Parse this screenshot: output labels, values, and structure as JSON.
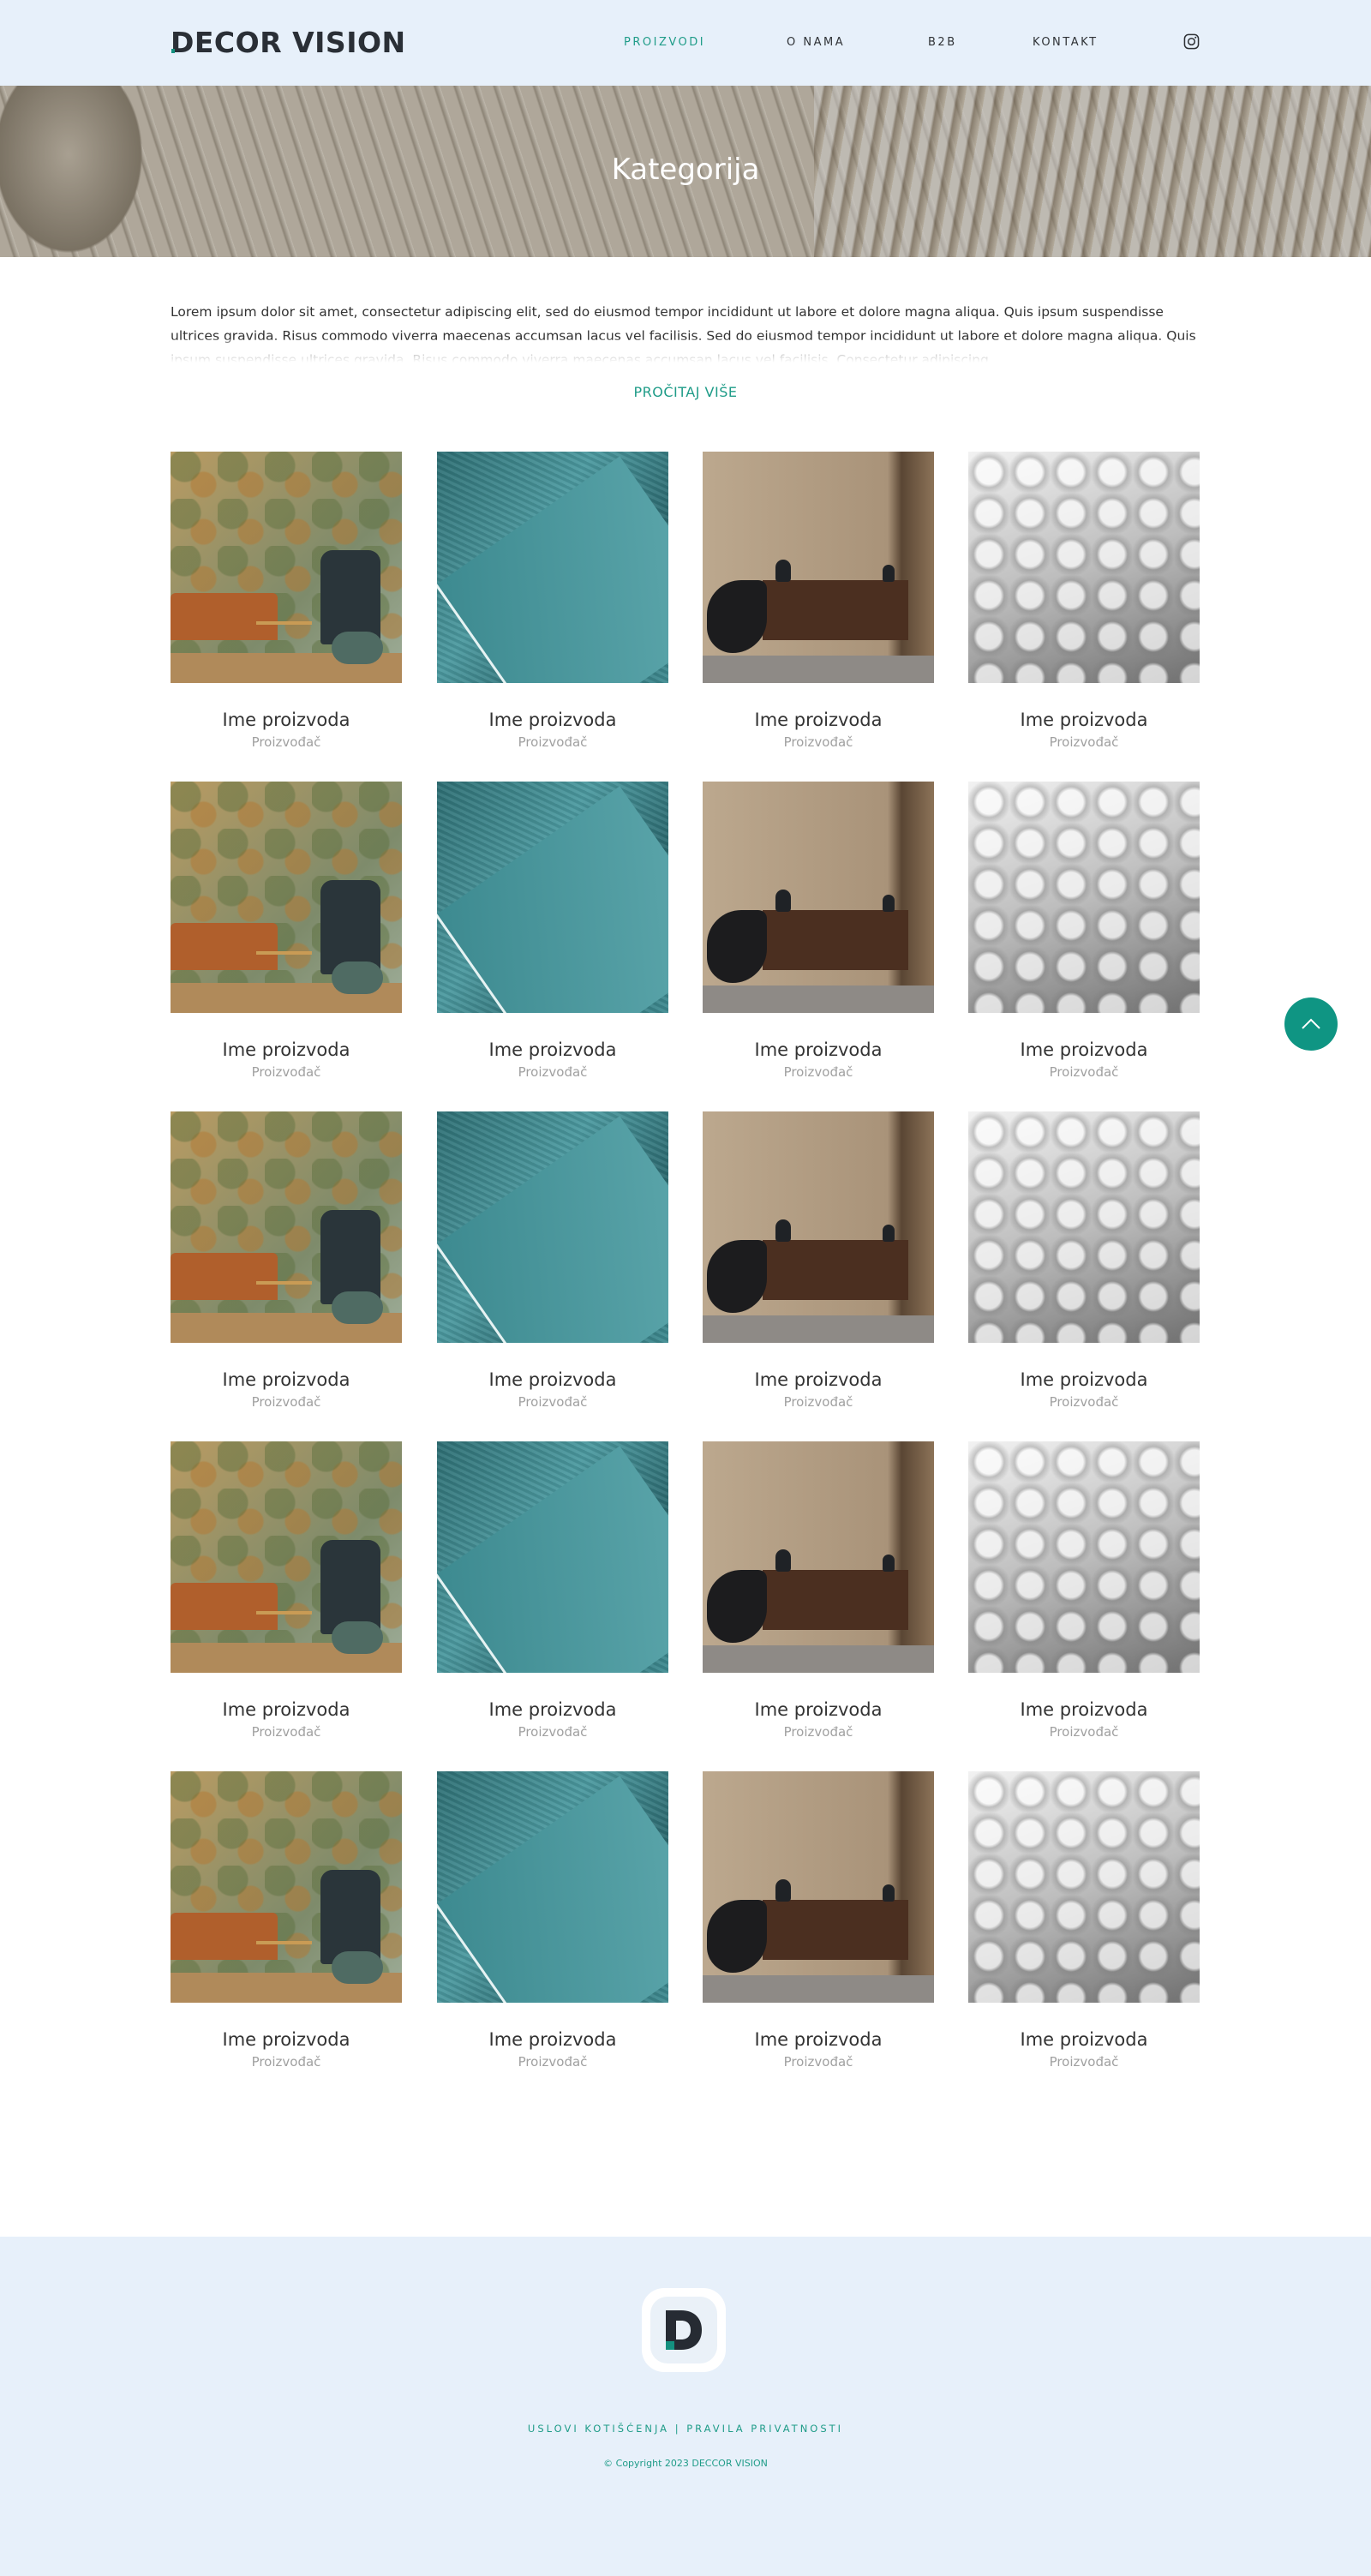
{
  "header": {
    "logo": "DECOR VISION",
    "nav": {
      "proizvodi": "PROIZVODI",
      "o_nama": "O NAMA",
      "b2b": "B2B",
      "kontakt": "KONTAKT"
    },
    "social_icon": "instagram-icon"
  },
  "hero": {
    "title": "Kategorija"
  },
  "intro": {
    "text": "Lorem ipsum dolor sit amet, consectetur adipiscing elit, sed do eiusmod tempor incididunt ut labore et dolore magna aliqua. Quis ipsum suspendisse ultrices gravida. Risus commodo viverra maecenas accumsan lacus vel facilisis. Sed do eiusmod tempor incididunt ut labore et dolore magna aliqua. Quis ipsum suspendisse ultrices gravida. Risus commodo viverra maecenas accumsan lacus vel facilisis. Consectetur adipiscing",
    "read_more": "PROČITAJ VIŠE"
  },
  "products": [
    {
      "name": "Ime proizvoda",
      "maker": "Proizvođač"
    },
    {
      "name": "Ime proizvoda",
      "maker": "Proizvođač"
    },
    {
      "name": "Ime proizvoda",
      "maker": "Proizvođač"
    },
    {
      "name": "Ime proizvoda",
      "maker": "Proizvođač"
    },
    {
      "name": "Ime proizvoda",
      "maker": "Proizvođač"
    },
    {
      "name": "Ime proizvoda",
      "maker": "Proizvođač"
    },
    {
      "name": "Ime proizvoda",
      "maker": "Proizvođač"
    },
    {
      "name": "Ime proizvoda",
      "maker": "Proizvođač"
    },
    {
      "name": "Ime proizvoda",
      "maker": "Proizvođač"
    },
    {
      "name": "Ime proizvoda",
      "maker": "Proizvođač"
    },
    {
      "name": "Ime proizvoda",
      "maker": "Proizvođač"
    },
    {
      "name": "Ime proizvoda",
      "maker": "Proizvođač"
    },
    {
      "name": "Ime proizvoda",
      "maker": "Proizvođač"
    },
    {
      "name": "Ime proizvoda",
      "maker": "Proizvođač"
    },
    {
      "name": "Ime proizvoda",
      "maker": "Proizvođač"
    },
    {
      "name": "Ime proizvoda",
      "maker": "Proizvođač"
    },
    {
      "name": "Ime proizvoda",
      "maker": "Proizvođač"
    },
    {
      "name": "Ime proizvoda",
      "maker": "Proizvođač"
    },
    {
      "name": "Ime proizvoda",
      "maker": "Proizvođač"
    },
    {
      "name": "Ime proizvoda",
      "maker": "Proizvođač"
    }
  ],
  "back_to_top_icon": "chevron-up-icon",
  "footer": {
    "logo_icon": "decor-vision-logo-icon",
    "terms": "USLOVI KOTIŠĆENJA",
    "separator": "|",
    "privacy": "PRAVILA PRIVATNOSTI",
    "copyright": "© Copyright 2023 DECCOR VISION"
  },
  "colors": {
    "accent": "#1f9c88",
    "button": "#0f9583",
    "header_bg": "#e7f0fa"
  }
}
